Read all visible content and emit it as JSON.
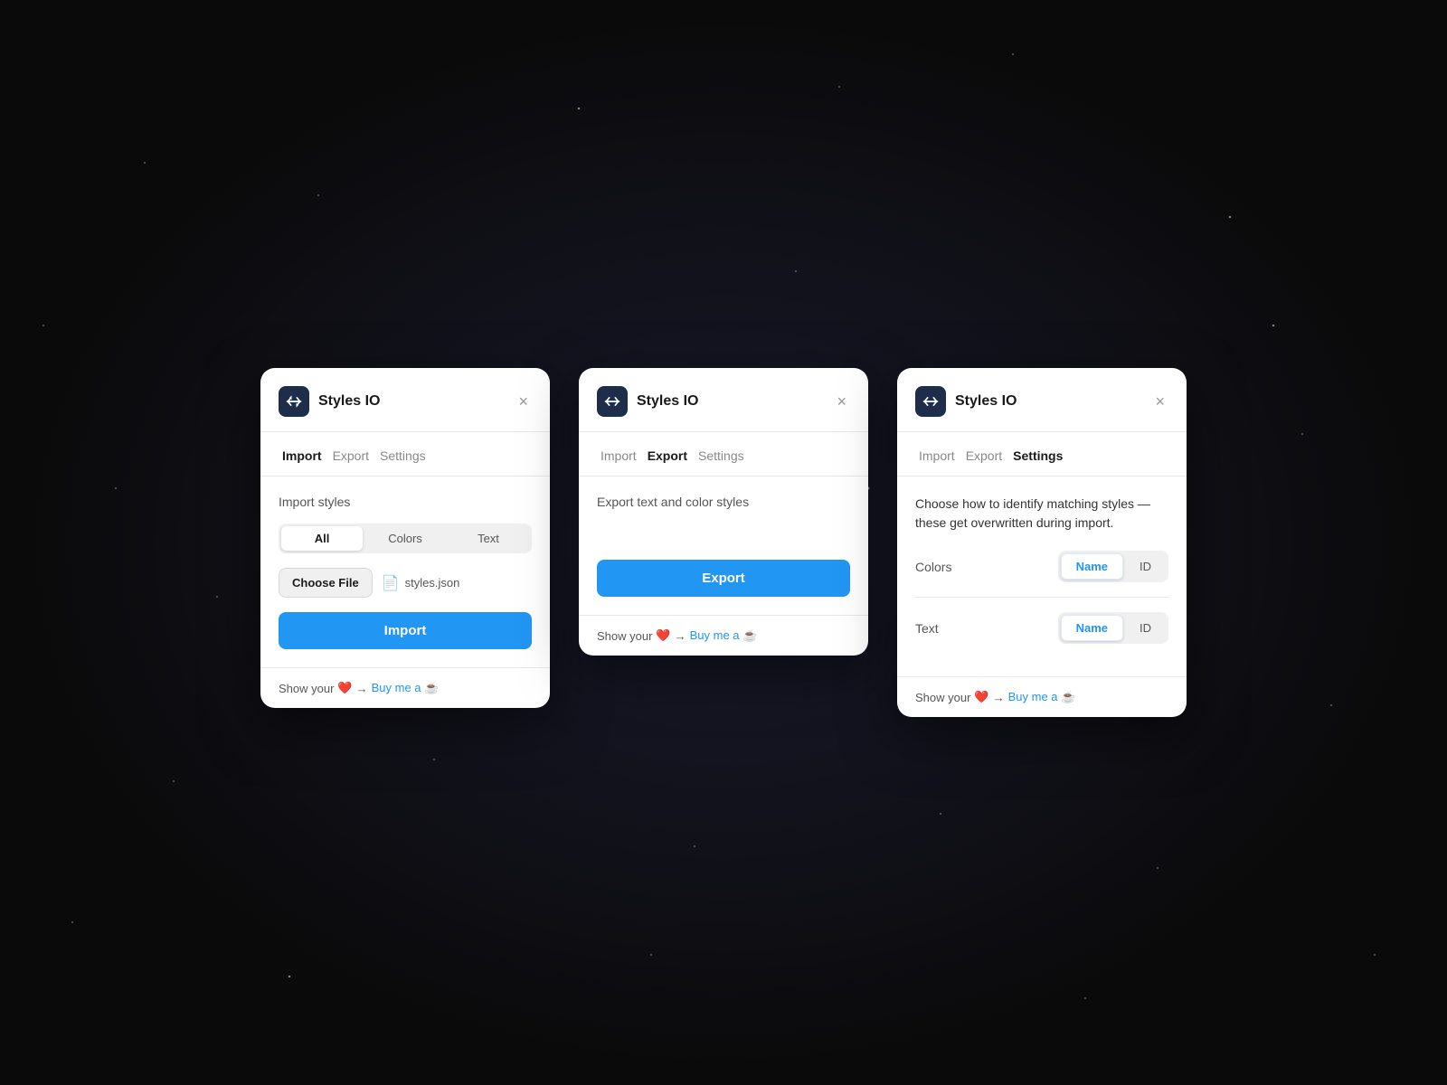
{
  "app": {
    "name": "Styles IO",
    "icon_label": "styles-io-icon"
  },
  "panels": [
    {
      "id": "import-panel",
      "tabs": [
        {
          "id": "import",
          "label": "Import",
          "active": true
        },
        {
          "id": "export",
          "label": "Export",
          "active": false
        },
        {
          "id": "settings",
          "label": "Settings",
          "active": false
        }
      ],
      "section_title": "Import styles",
      "filters": [
        {
          "id": "all",
          "label": "All",
          "active": true
        },
        {
          "id": "colors",
          "label": "Colors",
          "active": false
        },
        {
          "id": "text",
          "label": "Text",
          "active": false
        }
      ],
      "choose_file_label": "Choose File",
      "file_name": "styles.json",
      "import_btn": "Import",
      "footer_text": "Show your",
      "footer_heart": "❤️",
      "footer_arrow": "→",
      "footer_link_text": "Buy me a ☕",
      "footer_link_href": "#"
    },
    {
      "id": "export-panel",
      "tabs": [
        {
          "id": "import",
          "label": "Import",
          "active": false
        },
        {
          "id": "export",
          "label": "Export",
          "active": true
        },
        {
          "id": "settings",
          "label": "Settings",
          "active": false
        }
      ],
      "section_title": "Export text and color styles",
      "export_btn": "Export",
      "footer_text": "Show your",
      "footer_heart": "❤️",
      "footer_arrow": "→",
      "footer_link_text": "Buy me a ☕",
      "footer_link_href": "#"
    },
    {
      "id": "settings-panel",
      "tabs": [
        {
          "id": "import",
          "label": "Import",
          "active": false
        },
        {
          "id": "export",
          "label": "Export",
          "active": false
        },
        {
          "id": "settings",
          "label": "Settings",
          "active": true
        }
      ],
      "description": "Choose how to identify matching styles — these get overwritten during import.",
      "colors_label": "Colors",
      "colors_name_btn": "Name",
      "colors_id_btn": "ID",
      "text_label": "Text",
      "text_name_btn": "Name",
      "text_id_btn": "ID",
      "footer_text": "Show your",
      "footer_heart": "❤️",
      "footer_arrow": "→",
      "footer_link_text": "Buy me a ☕",
      "footer_link_href": "#"
    }
  ],
  "close_label": "×"
}
